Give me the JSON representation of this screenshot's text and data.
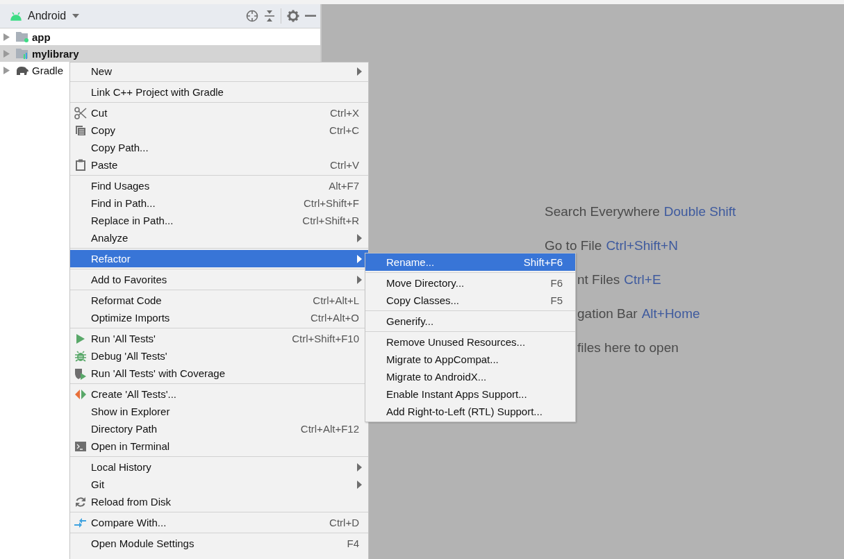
{
  "project_panel": {
    "view": "Android",
    "tree": [
      {
        "label": "app",
        "kind": "app",
        "selected": false
      },
      {
        "label": "mylibrary",
        "kind": "library",
        "selected": true
      },
      {
        "label": "Gradle",
        "kind": "gradle",
        "selected": false
      }
    ]
  },
  "context_menu": {
    "groups": [
      {
        "items": [
          {
            "label": "New",
            "submenu": true,
            "selected": false
          }
        ]
      },
      {
        "items": [
          {
            "label": "Link C++ Project with Gradle",
            "selected": false
          }
        ]
      },
      {
        "items": [
          {
            "label": "Cut",
            "shortcut": "Ctrl+X",
            "kind": "cut",
            "selected": false
          },
          {
            "label": "Copy",
            "shortcut": "Ctrl+C",
            "kind": "copy",
            "selected": false
          },
          {
            "label": "Copy Path...",
            "selected": false
          },
          {
            "label": "Paste",
            "shortcut": "Ctrl+V",
            "kind": "paste",
            "selected": false
          }
        ]
      },
      {
        "items": [
          {
            "label": "Find Usages",
            "shortcut": "Alt+F7",
            "selected": false
          },
          {
            "label": "Find in Path...",
            "shortcut": "Ctrl+Shift+F",
            "selected": false
          },
          {
            "label": "Replace in Path...",
            "shortcut": "Ctrl+Shift+R",
            "selected": false
          },
          {
            "label": "Analyze",
            "submenu": true,
            "selected": false
          }
        ]
      },
      {
        "items": [
          {
            "label": "Refactor",
            "submenu": true,
            "selected": true
          }
        ]
      },
      {
        "items": [
          {
            "label": "Add to Favorites",
            "submenu": true,
            "selected": false
          }
        ]
      },
      {
        "items": [
          {
            "label": "Reformat Code",
            "shortcut": "Ctrl+Alt+L",
            "selected": false
          },
          {
            "label": "Optimize Imports",
            "shortcut": "Ctrl+Alt+O",
            "selected": false
          }
        ]
      },
      {
        "items": [
          {
            "label": "Run 'All Tests'",
            "shortcut": "Ctrl+Shift+F10",
            "kind": "run",
            "selected": false
          },
          {
            "label": "Debug 'All Tests'",
            "kind": "debug",
            "selected": false
          },
          {
            "label": "Run 'All Tests' with Coverage",
            "kind": "coverage",
            "selected": false
          }
        ]
      },
      {
        "items": [
          {
            "label": "Create 'All Tests'...",
            "kind": "create",
            "selected": false
          },
          {
            "label": "Show in Explorer",
            "selected": false
          },
          {
            "label": "Directory Path",
            "shortcut": "Ctrl+Alt+F12",
            "selected": false
          },
          {
            "label": "Open in Terminal",
            "kind": "terminal",
            "selected": false
          }
        ]
      },
      {
        "items": [
          {
            "label": "Local History",
            "submenu": true,
            "selected": false
          },
          {
            "label": "Git",
            "submenu": true,
            "selected": false
          },
          {
            "label": "Reload from Disk",
            "kind": "reload",
            "selected": false
          }
        ]
      },
      {
        "items": [
          {
            "label": "Compare With...",
            "shortcut": "Ctrl+D",
            "kind": "compare",
            "selected": false
          }
        ]
      },
      {
        "items": [
          {
            "label": "Open Module Settings",
            "shortcut": "F4",
            "selected": false
          }
        ]
      }
    ]
  },
  "refactor_submenu": {
    "groups": [
      {
        "items": [
          {
            "label": "Rename...",
            "shortcut": "Shift+F6",
            "selected": true
          }
        ]
      },
      {
        "items": [
          {
            "label": "Move Directory...",
            "shortcut": "F6",
            "selected": false
          },
          {
            "label": "Copy Classes...",
            "shortcut": "F5",
            "selected": false
          }
        ]
      },
      {
        "items": [
          {
            "label": "Generify...",
            "selected": false
          }
        ]
      },
      {
        "items": [
          {
            "label": "Remove Unused Resources...",
            "selected": false
          },
          {
            "label": "Migrate to AppCompat...",
            "selected": false
          },
          {
            "label": "Migrate to AndroidX...",
            "selected": false
          },
          {
            "label": "Enable Instant Apps Support...",
            "selected": false
          },
          {
            "label": "Add Right-to-Left (RTL) Support...",
            "selected": false
          }
        ]
      }
    ]
  },
  "editor_hints": [
    {
      "label": "Search Everywhere",
      "shortcut": "Double Shift",
      "kind": "full"
    },
    {
      "label": "Go to File",
      "shortcut": "Ctrl+Shift+N",
      "kind": "full"
    },
    {
      "label": "nt Files",
      "shortcut": "Ctrl+E",
      "kind": "partial"
    },
    {
      "label": "gation Bar",
      "shortcut": "Alt+Home",
      "kind": "partial"
    },
    {
      "label": "files here to open",
      "kind": "partial"
    }
  ]
}
